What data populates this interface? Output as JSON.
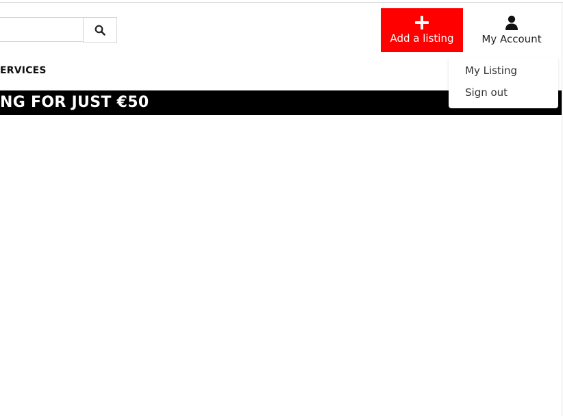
{
  "header": {
    "search": {
      "value": "",
      "placeholder": "",
      "button_icon": "search-icon"
    },
    "add_listing": {
      "label": "Add a listing",
      "icon": "plus-icon",
      "background_color": "#ff0000"
    },
    "account": {
      "label": "My Account",
      "icon": "user-icon",
      "menu": [
        {
          "label": "My Listing"
        },
        {
          "label": "Sign out"
        }
      ]
    }
  },
  "nav": {
    "visible_item": "ERVICES"
  },
  "promo": {
    "text": "NG FOR JUST €50",
    "background_color": "#000000"
  }
}
